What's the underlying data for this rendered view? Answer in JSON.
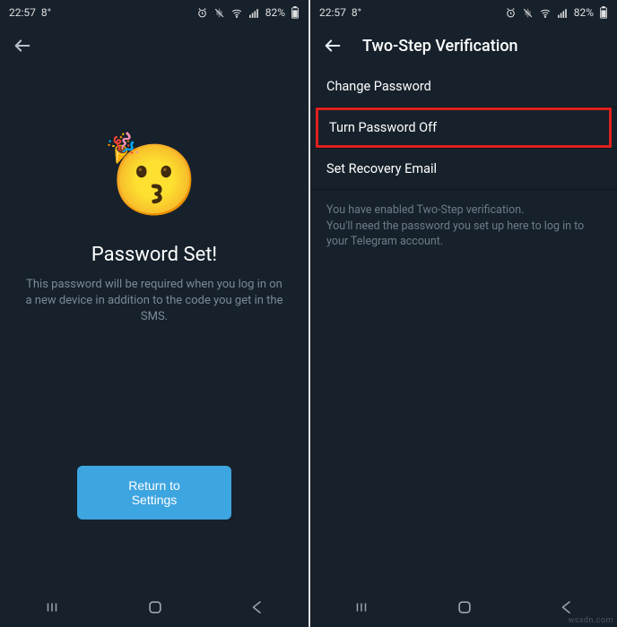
{
  "statusBar": {
    "time": "22:57",
    "temp": "8°",
    "battery": "82%"
  },
  "left": {
    "title": "Password Set!",
    "description": "This password will be required when you log in on a new device in addition to the code you get in the SMS.",
    "button": "Return to Settings"
  },
  "right": {
    "toolbarTitle": "Two-Step Verification",
    "items": {
      "changePassword": "Change Password",
      "turnPasswordOff": "Turn Password Off",
      "setRecoveryEmail": "Set Recovery Email"
    },
    "info": "You have enabled Two-Step verification.\nYou'll need the password you set up here to log in to your Telegram account."
  },
  "watermark": "wsxdn.com"
}
